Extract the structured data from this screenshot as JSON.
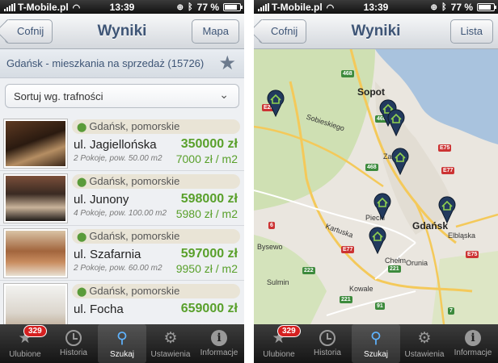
{
  "status": {
    "carrier": "T-Mobile.pl",
    "time": "13:39",
    "battery": "77 %"
  },
  "left": {
    "nav_title": "Wyniki",
    "back_label": "Cofnij",
    "right_label": "Mapa",
    "search_header": "Gdańsk - mieszkania na sprzedaż (15726)",
    "sort_label": "Sortuj wg. trafności",
    "listings": [
      {
        "location": "Gdańsk, pomorskie",
        "street": "ul. Jagiellońska",
        "price": "350000 zł",
        "details": "2 Pokoje, pow. 50.00 m2",
        "price_per_m2": "7000 zł / m2"
      },
      {
        "location": "Gdańsk, pomorskie",
        "street": "ul. Junony",
        "price": "598000 zł",
        "details": "4 Pokoje, pow. 100.00 m2",
        "price_per_m2": "5980 zł / m2"
      },
      {
        "location": "Gdańsk, pomorskie",
        "street": "ul. Szafarnia",
        "price": "597000 zł",
        "details": "2 Pokoje, pow. 60.00 m2",
        "price_per_m2": "9950 zł / m2"
      },
      {
        "location": "Gdańsk, pomorskie",
        "street": "ul. Focha",
        "price": "659000 zł"
      }
    ]
  },
  "right": {
    "nav_title": "Wyniki",
    "back_label": "Cofnij",
    "right_label": "Lista",
    "map_labels": {
      "sopot": "Sopot",
      "gdansk": "Gdańsk",
      "bysewo": "Bysewo",
      "chelm": "Chełm",
      "orunia": "Orunia",
      "kowale": "Kowale",
      "sulmin": "Sulmin",
      "piecki": "Piecki",
      "kartuska": "Kartuska",
      "sobieskiego": "Sobieskiego",
      "elblaska": "Elbląska",
      "zab": "Zab"
    },
    "road_numbers": [
      "468",
      "468",
      "468",
      "E28",
      "E75",
      "E77",
      "E77",
      "E75",
      "221",
      "221",
      "222",
      "7",
      "6",
      "91"
    ]
  },
  "tabs": [
    {
      "label": "Ulubione",
      "icon": "star-icon",
      "badge": "329"
    },
    {
      "label": "Historia",
      "icon": "clock-icon"
    },
    {
      "label": "Szukaj",
      "icon": "magnifier-icon",
      "active": true
    },
    {
      "label": "Ustawienia",
      "icon": "gear-icon"
    },
    {
      "label": "Informacje",
      "icon": "info-icon"
    }
  ],
  "colors": {
    "price_green": "#59a02b",
    "nav_text": "#3e5576",
    "pin": "#223a5e",
    "badge": "#d52020"
  }
}
